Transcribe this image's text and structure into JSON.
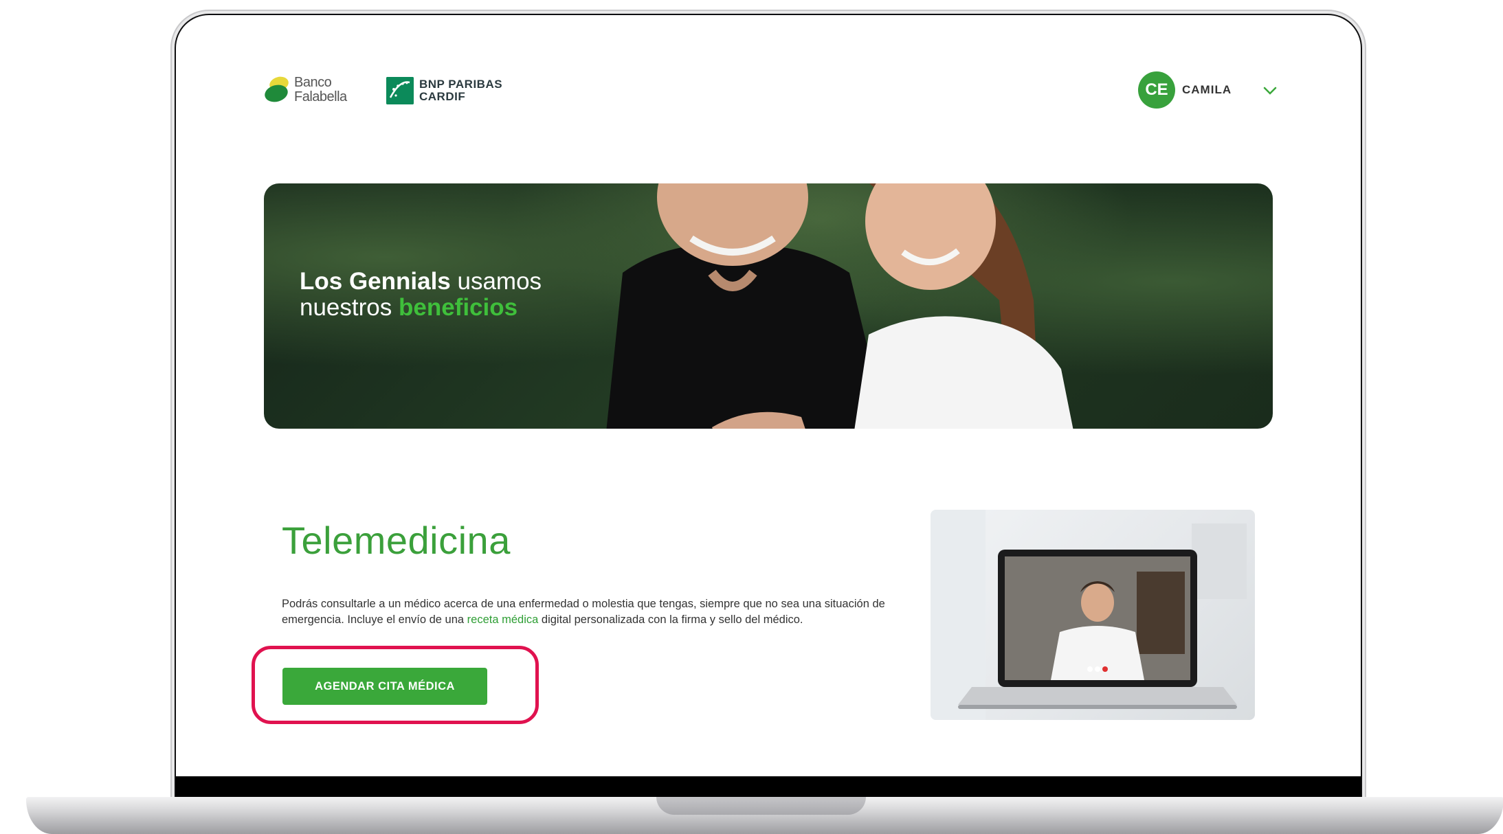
{
  "header": {
    "falabella": {
      "line1": "Banco",
      "line2": "Falabella"
    },
    "bnp": {
      "line1": "BNP PARIBAS",
      "line2": "CARDIF"
    },
    "user": {
      "initials": "CE",
      "name": "CAMILA"
    }
  },
  "hero": {
    "line1_bold": "Los Gennials",
    "line1_rest": " usamos",
    "line2_rest": "nuestros ",
    "line2_accent": "beneficios"
  },
  "telemedicina": {
    "title": "Telemedicina",
    "desc_part1": "Podrás consultarle a un médico acerca de una enfermedad o molestia que tengas, siempre que no sea una situación de emergencia. Incluye el envío de una ",
    "desc_link": "receta médica",
    "desc_part2": " digital personalizada con la firma y sello del médico.",
    "cta_label": "AGENDAR CITA MÉDICA"
  },
  "colors": {
    "brand_green": "#3aa83a",
    "highlight": "#e0124f"
  }
}
